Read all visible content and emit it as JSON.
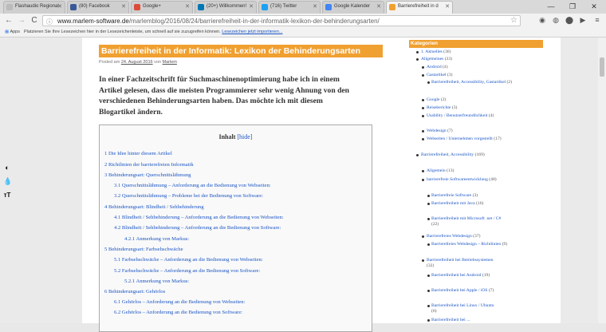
{
  "browser": {
    "tabs": [
      {
        "label": "Flashaudio Regional",
        "icon": "flash-icon",
        "color": "#d0d0d0"
      },
      {
        "label": "(80) Facebook",
        "icon": "facebook-icon",
        "color": "#3b5998"
      },
      {
        "label": "Google+",
        "icon": "google-plus-icon",
        "color": "#dd4b39"
      },
      {
        "label": "(20+) Willkommen!",
        "icon": "linkedin-icon",
        "color": "#0077b5"
      },
      {
        "label": "(716) Twitter",
        "icon": "twitter-icon",
        "color": "#1da1f2"
      },
      {
        "label": "Google Kalender",
        "icon": "calendar-icon",
        "color": "#4285f4"
      },
      {
        "label": "Barrierefreiheit in d",
        "icon": "site-icon",
        "color": "#f0a030"
      }
    ],
    "window_controls": {
      "minimize": "—",
      "restore": "❐",
      "close": "✕"
    },
    "nav": {
      "back": "←",
      "forward": "→",
      "reload": "C"
    },
    "url_domain": "www.marlem-software.de",
    "url_path": "/marlemblog/2016/08/24/barrierefreiheit-in-der-informatik-lexikon-der-behinderungsarten/",
    "bookmarks": {
      "apps_label": "Apps",
      "hint_text": "Platzieren Sie Ihre Lesezeichen hier in der Lesezeichenleiste, um schnell auf sie zuzugreifen können.",
      "hint_link": "Lesezeichen jetzt importieren..."
    }
  },
  "article": {
    "title": "Barrierefreiheit in der Informatik: Lexikon der Behinderungsarten",
    "meta_prefix": "Posted am",
    "meta_date": "24. August 2016",
    "meta_by": "von",
    "meta_author": "Marlem",
    "intro_lines": [
      "In einer Fachzeitschrift für Suchmaschinenoptimierung habe ich in einem",
      "Artikel gelesen, dass die meisten Programmierer sehr wenig Ahnung von den",
      "verschiedenen Behinderungsarten haben. Das möchte ich mit diesem",
      "Blogartikel ändern."
    ],
    "toc": {
      "heading": "Inhalt",
      "toggle": "[hide]",
      "items": [
        "1 Die Idee hinter diesem Artikel",
        "2 Richtlinien der barrierefreien Informatik",
        "3 Behinderungsart: Querschnittslähmung",
        "3.1 Querschnittslähmung – Anforderung an die Bedienung von Webseiten:",
        "3.2 Querschnittslähmung – Probleme bei der Bedienung von Software:",
        "4 Behinderungsart: Blindheit / Sehbehinderung",
        "4.1 Blindheit / Sehbehinderung – Anforderung an die Bedienung von Webseiten:",
        "4.2 Blindheit / Sehbehinderung – Anforderung an die Bedienung von Software:",
        "4.2.1 Anmerkung von Markus:",
        "5 Behinderungsart: Farbsehschwäche",
        "5.1 Farbsehschwäche – Anforderung an die Bedienung von Webseiten:",
        "5.2 Farbsehschwäche – Anforderung an die Bedienung von Software:",
        "5.2.1 Anmerkung von Markus:",
        "6 Behinderungsart: Gehörlos",
        "6.1 Gehörlos – Anforderung an die Bedienung von Webseiten:",
        "6.2 Gehörlos – Anforderung an die Bedienung von Software:"
      ]
    }
  },
  "sidebar": {
    "heading": "Kategorien",
    "items": [
      {
        "label": "1. Aktuelles",
        "count": "(36)"
      },
      {
        "label": "Allgemeines",
        "count": "(33)"
      },
      {
        "label": "Android",
        "count": "(4)"
      },
      {
        "label": "Gastartikel",
        "count": "(3)"
      },
      {
        "label": "Barrierefreiheit, Accessibility, Gastartikel",
        "count": "(2)"
      },
      {
        "label": "Google",
        "count": "(2)"
      },
      {
        "label": "Reiseberichte",
        "count": "(3)"
      },
      {
        "label": "Usability / Benutzerfreundlichkeit",
        "count": "(4)"
      },
      {
        "label": "Webdesign",
        "count": "(7)"
      },
      {
        "label": "Webseiten / Unternehmen vorgestellt",
        "count": "(17)"
      },
      {
        "label": "Barrierefreiheit, Accessibility",
        "count": "(169)"
      },
      {
        "label": "Allgemein",
        "count": "(13)"
      },
      {
        "label": "barrierefreie Softwareentwicklung",
        "count": "(48)"
      },
      {
        "label": "Barrierefreie Software",
        "count": "(3)"
      },
      {
        "label": "Barrierefreiheit mit Java",
        "count": "(16)"
      },
      {
        "label": "Barrierefreiheit mit Microsoft .net / C#",
        "count": "(22)"
      },
      {
        "label": "Barrierefreies Webdesign",
        "count": "(37)"
      },
      {
        "label": "Barrierefreies Webdesign – Richtlinien",
        "count": "(9)"
      },
      {
        "label": "Barrierefreiheit bei Betriebssystemen",
        "count": "(32)"
      },
      {
        "label": "Barrierefreiheit bei Android",
        "count": "(19)"
      },
      {
        "label": "Barrierefreiheit bei Apple / iOS",
        "count": "(7)"
      },
      {
        "label": "Barrierefreiheit bei Linux / Ubuntu",
        "count": "(6)"
      },
      {
        "label": "Barrierefreiheit bei ...",
        "count": ""
      }
    ]
  },
  "a11y_tools": {
    "contrast": "contrast-icon",
    "drop": "drop-icon",
    "text_size": "text-size-icon"
  }
}
